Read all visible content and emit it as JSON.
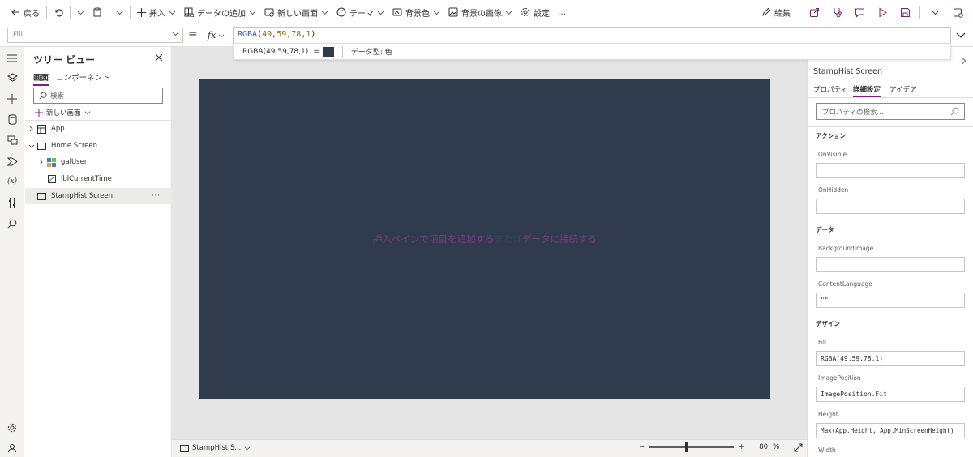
{
  "toolbar": {
    "back": "戻る",
    "insert": "挿入",
    "add_data": "データの追加",
    "new_screen": "新しい画面",
    "theme": "テーマ",
    "background_color": "背景色",
    "background_image": "背景の画像",
    "settings": "設定",
    "more": "…",
    "edit": "編集"
  },
  "formula_bar": {
    "property": "Fill",
    "equals": "=",
    "fx": "fx",
    "fn": "RGBA",
    "args": [
      "49",
      "59",
      "78",
      "1"
    ],
    "hint_value": "RGBA(49,59,78,1)",
    "hint_eq": "=",
    "hint_type": "データ型: 色",
    "swatch_color": "#313b4e"
  },
  "tree": {
    "title": "ツリー ビュー",
    "tabs": [
      "画面",
      "コンポーネント"
    ],
    "search_placeholder": "検索",
    "new_screen": "新しい画面",
    "items": [
      {
        "label": "App"
      },
      {
        "label": "Home Screen"
      },
      {
        "label": "galUser"
      },
      {
        "label": "lblCurrentTime"
      },
      {
        "label": "StampHist Screen",
        "more": "···"
      }
    ]
  },
  "canvas": {
    "hint_part1": "挿入ペインで項目を追加する",
    "hint_or": "または",
    "hint_part2": "データに接続する",
    "screen_selector": "StampHist S...",
    "zoom_minus": "−",
    "zoom_plus": "+",
    "zoom_value": "80",
    "zoom_unit": "%",
    "zoom_level": 0.8
  },
  "props": {
    "title": "StampHist Screen",
    "tabs": [
      "プロパティ",
      "詳細設定",
      "アイデア"
    ],
    "search_placeholder": "プロパティの検索...",
    "sections": {
      "actions": "アクション",
      "data": "データ",
      "design": "デザイン"
    },
    "on_visible_label": "OnVisible",
    "on_visible_value": "",
    "on_hidden_label": "OnHidden",
    "on_hidden_value": "",
    "bg_image_label": "BackgroundImage",
    "bg_image_value": "",
    "content_lang_label": "ContentLanguage",
    "content_lang_value": "\"\"",
    "fill_label": "Fill",
    "fill_value": "RGBA(49,59,78,1)",
    "image_pos_label": "ImagePosition",
    "image_pos_value": "ImagePosition.Fit",
    "height_label": "Height",
    "height_value": "Max(App.Height, App.MinScreenHeight)",
    "width_label": "Width"
  }
}
